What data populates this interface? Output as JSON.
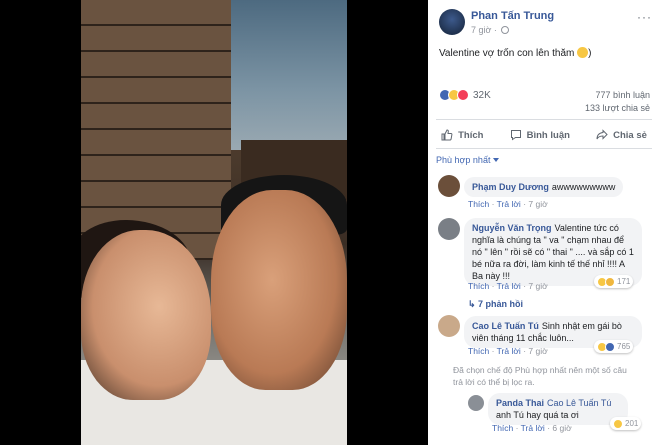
{
  "post": {
    "author": "Phan Tấn Trung",
    "time": "7 giờ",
    "more": "···",
    "text": "Valentine vợ trốn con lên thăm",
    "reaction_count": "32K",
    "comment_count": "777 bình luận",
    "share_count": "133 lượt chia sẻ"
  },
  "actions": {
    "like": "Thích",
    "comment": "Bình luận",
    "share": "Chia sẻ"
  },
  "sort_label": "Phù hợp nhất",
  "comments": [
    {
      "name": "Phạm Duy Dương",
      "text": "awwwwwwwww",
      "like": "Thích",
      "reply": "Trả lời",
      "time": "7 giờ"
    },
    {
      "name": "Nguyễn Văn Trọng",
      "text": "Valentine tức có nghĩa là chúng ta \" va \" chạm nhau để nó \" lên \" rồi sẽ có \" thai \" .... và sắp có 1 bé nữa ra đời, làm kinh tế thế nhỉ !!!! A Ba này !!!",
      "like": "Thích",
      "reply": "Trả lời",
      "time": "7 giờ",
      "reactions": "171",
      "replies": "7 phản hồi"
    },
    {
      "name": "Cao Lê Tuấn Tú",
      "text": "Sinh nhật em gái bò viên tháng 11 chắc luôn...",
      "like": "Thích",
      "reply": "Trả lời",
      "time": "7 giờ",
      "reactions": "765"
    },
    {
      "name": "Panda Thai",
      "mention": "Cao Lê Tuấn Tú",
      "text": "anh Tú hay quá ta ơi",
      "like": "Thích",
      "reply": "Trả lời",
      "time": "6 giờ",
      "reactions": "201"
    }
  ],
  "filter_note": "Đã chọn chế độ Phù hợp nhất nên một số câu trả lời có thể bị lọc ra.",
  "colors": {
    "link": "#385898",
    "accent": "#4267b2",
    "muted": "#90949c"
  }
}
